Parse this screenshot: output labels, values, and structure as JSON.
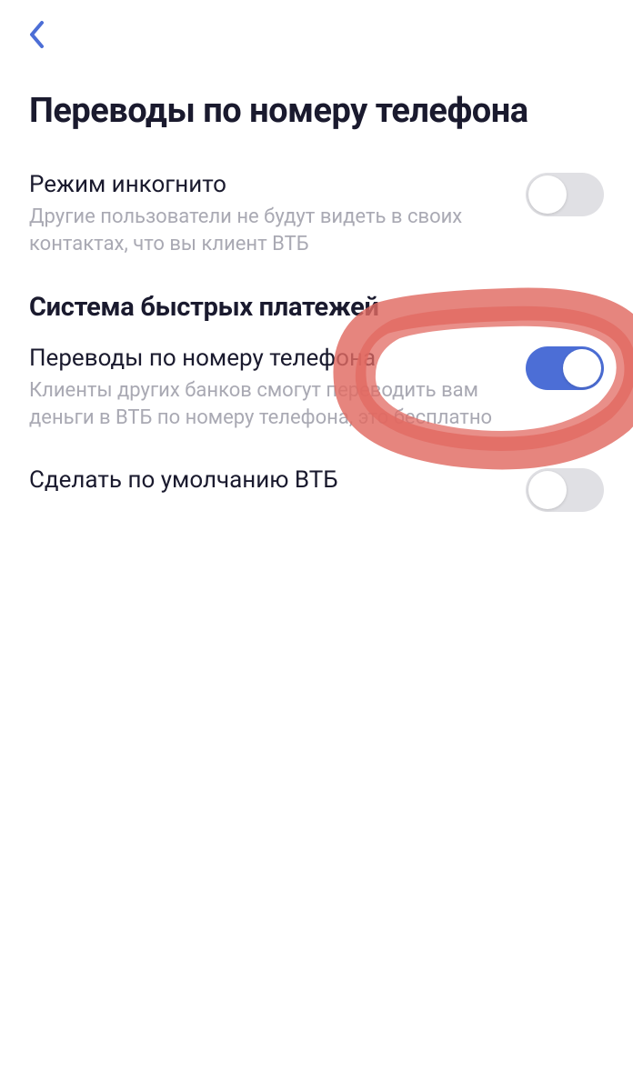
{
  "header": {
    "back_icon_name": "chevron-left-icon"
  },
  "page": {
    "title": "Переводы по номеру телефона"
  },
  "settings": {
    "incognito": {
      "title": "Режим инкогнито",
      "description": "Другие пользователи не будут видеть в своих контактах, что вы клиент ВТБ",
      "enabled": false
    },
    "sbp_section": {
      "header": "Система быстрых платежей"
    },
    "phone_transfers": {
      "title": "Переводы по номеру телефона",
      "description": "Клиенты других банков смогут переводить вам деньги в ВТБ по номеру телефона, это бесплатно",
      "enabled": true
    },
    "default_vtb": {
      "title": "Сделать по умолчанию ВТБ",
      "enabled": false
    }
  },
  "colors": {
    "accent": "#4c6ed6",
    "text_primary": "#1a1a2e",
    "text_secondary": "#a9a9b3",
    "toggle_off": "#e0e0e4",
    "annotation": "#e16a62"
  }
}
